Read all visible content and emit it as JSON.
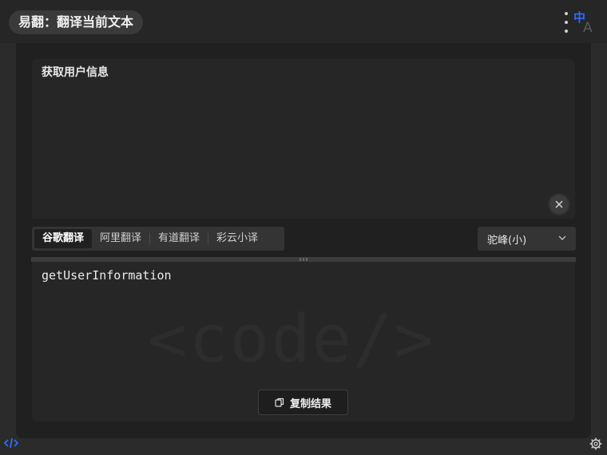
{
  "titlebar": {
    "title": "易翻：翻译当前文本",
    "lang_icon_top": "中",
    "lang_icon_bottom": "A"
  },
  "source": {
    "text": "获取用户信息"
  },
  "tabs": [
    {
      "label": "谷歌翻译",
      "active": true
    },
    {
      "label": "阿里翻译",
      "active": false
    },
    {
      "label": "有道翻译",
      "active": false
    },
    {
      "label": "彩云小译",
      "active": false
    }
  ],
  "style_select": {
    "value": "驼峰(小)"
  },
  "result": {
    "text": "getUserInformation",
    "watermark": "<code/>"
  },
  "copy_button": {
    "label": "复制结果"
  },
  "colors": {
    "accent": "#2f6bff",
    "background": "#202020",
    "panel": "#262626"
  }
}
